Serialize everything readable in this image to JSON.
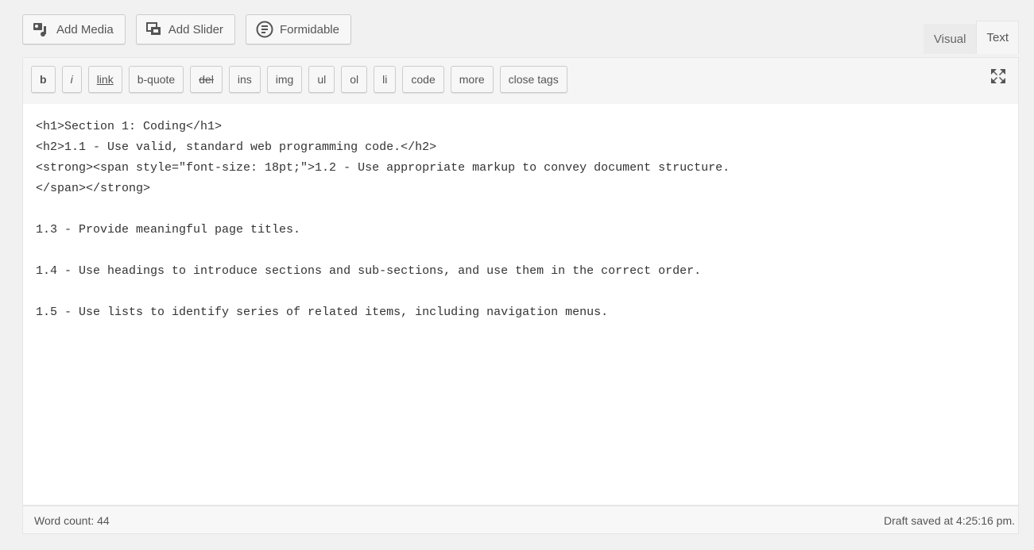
{
  "media_buttons": [
    {
      "label": "Add Media",
      "icon": "add-media-icon"
    },
    {
      "label": "Add Slider",
      "icon": "add-slider-icon"
    },
    {
      "label": "Formidable",
      "icon": "formidable-icon"
    }
  ],
  "mode_tabs": {
    "visual": "Visual",
    "text": "Text",
    "active": "Text"
  },
  "quicktags": [
    "b",
    "i",
    "link",
    "b-quote",
    "del",
    "ins",
    "img",
    "ul",
    "ol",
    "li",
    "code",
    "more",
    "close tags"
  ],
  "content_lines": [
    "<h1>Section 1: Coding</h1>",
    "<h2>1.1 - Use valid, standard web programming code.</h2>",
    "<strong><span style=\"font-size: 18pt;\">1.2 - Use appropriate markup to convey document structure.",
    "</span></strong>",
    "",
    "1.3 - Provide meaningful page titles.",
    "",
    "1.4 - Use headings to introduce sections and sub-sections, and use them in the correct order.",
    "",
    "1.5 - Use lists to identify series of related items, including navigation menus."
  ],
  "status": {
    "word_count": "Word count: 44",
    "draft": "Draft saved at 4:25:16 pm."
  },
  "colors": {
    "background": "#f1f1f1",
    "toolbar": "#f5f5f5",
    "editor": "#ffffff",
    "text": "#333333"
  }
}
